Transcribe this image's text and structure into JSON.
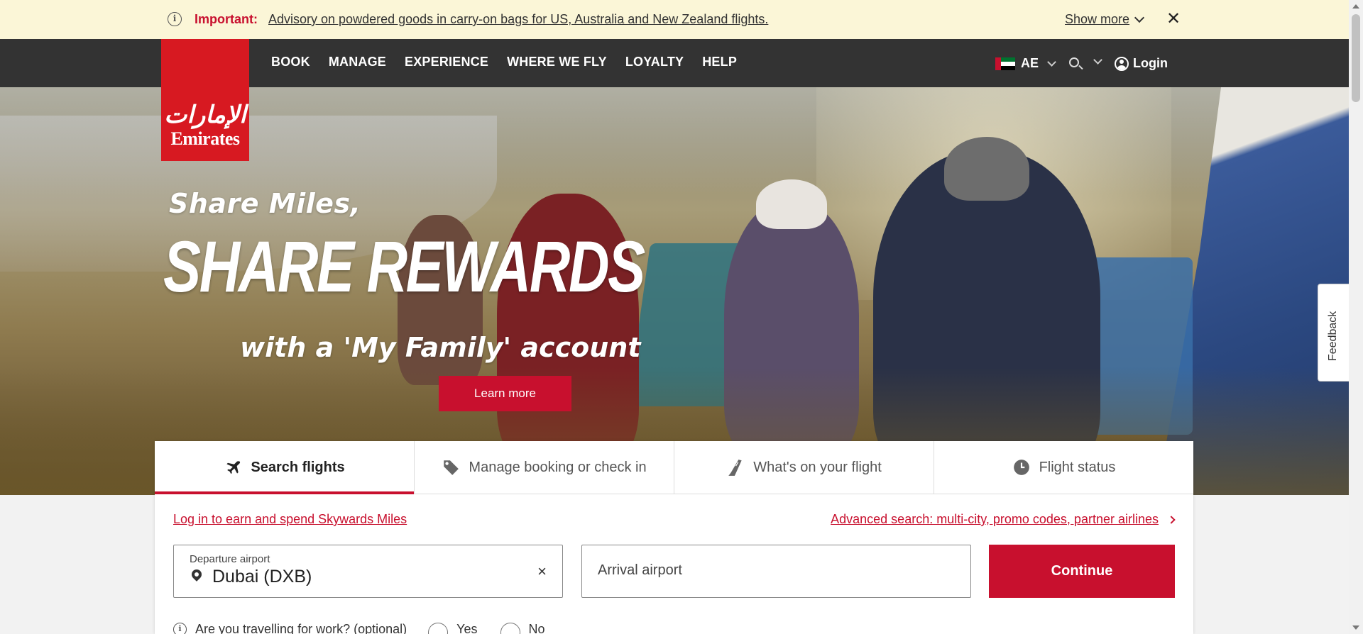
{
  "advisory": {
    "info_icon": "info-icon",
    "label": "Important:",
    "message": "Advisory on powdered goods in carry-on bags for US, Australia and New Zealand flights.",
    "show_more": "Show more",
    "close": "✕"
  },
  "nav": {
    "items": [
      "BOOK",
      "MANAGE",
      "EXPERIENCE",
      "WHERE WE FLY",
      "LOYALTY",
      "HELP"
    ],
    "locale": "AE",
    "login": "Login"
  },
  "logo": {
    "mark": "ﺍﻹﻣﺎﺭﺍﺕ",
    "word": "Emirates"
  },
  "hero": {
    "sub1": "Share Miles,",
    "title": "SHARE REWARDS",
    "sub2": "with a 'My Family' account",
    "button": "Learn more"
  },
  "feedback": "Feedback",
  "widget": {
    "tabs": [
      {
        "label": "Search flights",
        "icon": "plane-icon",
        "active": true
      },
      {
        "label": "Manage booking or check in",
        "icon": "tag-icon",
        "active": false
      },
      {
        "label": "What's on your flight",
        "icon": "seat-icon",
        "active": false
      },
      {
        "label": "Flight status",
        "icon": "clock-icon",
        "active": false
      }
    ],
    "skywards_link": "Log in to earn and spend Skywards Miles",
    "advanced_link": "Advanced search: multi-city, promo codes, partner airlines",
    "departure": {
      "label": "Departure airport",
      "value": "Dubai (DXB)",
      "clear": "×"
    },
    "arrival": {
      "placeholder": "Arrival airport"
    },
    "continue": "Continue",
    "work_question": "Are you travelling for work? (optional)",
    "yes": "Yes",
    "no": "No"
  },
  "colors": {
    "brand_red": "#c8102e",
    "nav_bg": "#333333",
    "advisory_bg": "#fbf6d7"
  }
}
